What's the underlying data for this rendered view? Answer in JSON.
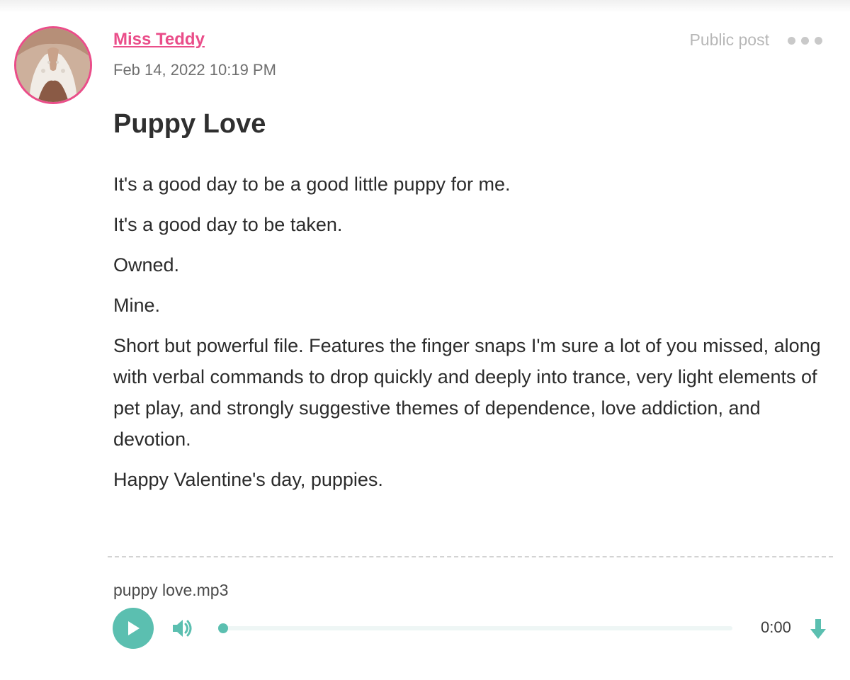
{
  "post": {
    "author": "Miss Teddy",
    "timestamp": "Feb 14, 2022 10:19 PM",
    "visibility": "Public post",
    "title": "Puppy Love",
    "paragraphs": [
      "It's a good day to be a good little puppy for me.",
      "It's a good day to be taken.",
      "Owned.",
      "Mine.",
      "Short but powerful file. Features the finger snaps I'm sure a lot of you missed, along with verbal commands to drop quickly and deeply into trance, very light elements of pet play, and strongly suggestive themes of dependence, love addiction, and devotion.",
      "Happy Valentine's day, puppies."
    ]
  },
  "audio": {
    "filename": "puppy love.mp3",
    "time": "0:00",
    "progress": 0,
    "play_icon": "play-icon",
    "volume_icon": "volume-icon",
    "download_icon": "download-icon"
  },
  "colors": {
    "accent_pink": "#ea4d89",
    "accent_teal": "#5bbfb0",
    "muted_text": "#b7b7b7"
  }
}
